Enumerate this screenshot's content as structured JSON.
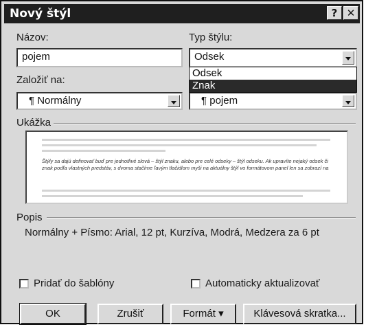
{
  "window": {
    "title": "Nový štýl",
    "help_glyph": "?",
    "close_glyph": "✕"
  },
  "nazov": {
    "label": "Názov:",
    "value": "pojem"
  },
  "typ": {
    "label": "Typ štýlu:",
    "value": "Odsek",
    "options": [
      "Odsek",
      "Znak"
    ],
    "selected_option": "Znak"
  },
  "zalozit": {
    "label": "Založiť na:",
    "value": "¶ Normálny"
  },
  "nasledujuci": {
    "value": "¶ pojem"
  },
  "ukazka": {
    "label": "Ukážka",
    "sample_text": "Štýly sa dajú definovať buď pre jednotlivé slová – štýl znaku, alebo pre celé odseky – štýl odseku. Ak upravíte nejaký odsek či znak podľa vlastných predstáv, s dvoma stačíme ľavým tlačidlom myši na aktuálny štýl vo formátovom panel len sa zobrazí na"
  },
  "popis": {
    "label": "Popis",
    "text": "Normálny + Písmo: Arial, 12 pt, Kurzíva, Modrá, Medzera  za 6 pt"
  },
  "checkbox_sablona": {
    "label": "Pridať do šablóny",
    "checked": false
  },
  "checkbox_auto": {
    "label": "Automaticky aktualizovať",
    "checked": false
  },
  "buttons": {
    "ok": "OK",
    "cancel": "Zrušiť",
    "format": "Formát ▾",
    "shortcut": "Klávesová skratka..."
  }
}
